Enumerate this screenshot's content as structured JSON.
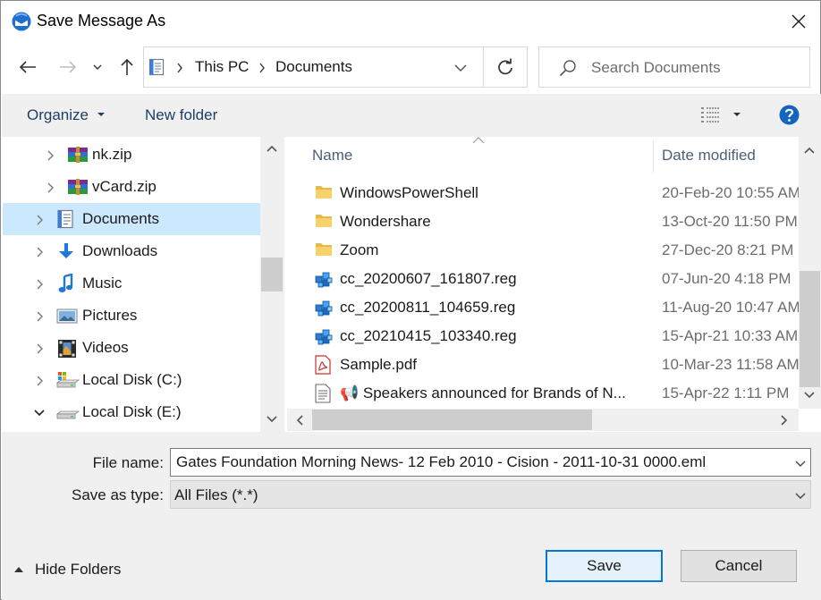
{
  "window": {
    "title": "Save Message As"
  },
  "address": {
    "crumbs": [
      "This PC",
      "Documents"
    ]
  },
  "search": {
    "placeholder": "Search Documents"
  },
  "toolbar": {
    "organize": "Organize",
    "new_folder": "New folder"
  },
  "tree": [
    {
      "label": "nk.zip",
      "icon": "zip-archive-icon",
      "level": 1,
      "expanded": false,
      "selected": false
    },
    {
      "label": "vCard.zip",
      "icon": "zip-archive-icon",
      "level": 1,
      "expanded": false,
      "selected": false
    },
    {
      "label": "Documents",
      "icon": "documents-icon",
      "level": 0,
      "expanded": false,
      "selected": true
    },
    {
      "label": "Downloads",
      "icon": "downloads-icon",
      "level": 0,
      "expanded": false,
      "selected": false
    },
    {
      "label": "Music",
      "icon": "music-icon",
      "level": 0,
      "expanded": false,
      "selected": false
    },
    {
      "label": "Pictures",
      "icon": "pictures-icon",
      "level": 0,
      "expanded": false,
      "selected": false
    },
    {
      "label": "Videos",
      "icon": "videos-icon",
      "level": 0,
      "expanded": false,
      "selected": false
    },
    {
      "label": "Local Disk (C:)",
      "icon": "local-disk-c-icon",
      "level": 0,
      "expanded": false,
      "selected": false
    },
    {
      "label": "Local Disk (E:)",
      "icon": "local-disk-icon",
      "level": 0,
      "expanded": true,
      "selected": false
    }
  ],
  "columns": {
    "name": "Name",
    "date": "Date modified"
  },
  "files": [
    {
      "name": "WindowsPowerShell",
      "date": "20-Feb-20 10:55 AM",
      "icon": "folder-icon"
    },
    {
      "name": "Wondershare",
      "date": "13-Oct-20 11:50 PM",
      "icon": "folder-icon"
    },
    {
      "name": "Zoom",
      "date": "27-Dec-20 8:21 PM",
      "icon": "folder-icon"
    },
    {
      "name": "cc_20200607_161807.reg",
      "date": "07-Jun-20 4:18 PM",
      "icon": "registry-file-icon"
    },
    {
      "name": "cc_20200811_104659.reg",
      "date": "11-Aug-20 10:47 AM",
      "icon": "registry-file-icon"
    },
    {
      "name": "cc_20210415_103340.reg",
      "date": "15-Apr-21 10:33 AM",
      "icon": "registry-file-icon"
    },
    {
      "name": "Sample.pdf",
      "date": "10-Mar-23 11:58 AM",
      "icon": "pdf-file-icon"
    },
    {
      "name": "📢 Speakers announced for Brands of N...",
      "date": "15-Apr-22 1:11 PM",
      "icon": "text-file-icon"
    }
  ],
  "form": {
    "file_name_label": "File name:",
    "file_name_value": "Gates Foundation Morning News- 12 Feb 2010 - Cision - 2011-10-31 0000.eml",
    "save_type_label": "Save as type:",
    "save_type_value": "All Files (*.*)"
  },
  "footer": {
    "hide_folders": "Hide Folders",
    "save": "Save",
    "cancel": "Cancel"
  },
  "colors": {
    "accent": "#0078d7",
    "selection": "#cce8ff",
    "help": "#1565c0"
  }
}
